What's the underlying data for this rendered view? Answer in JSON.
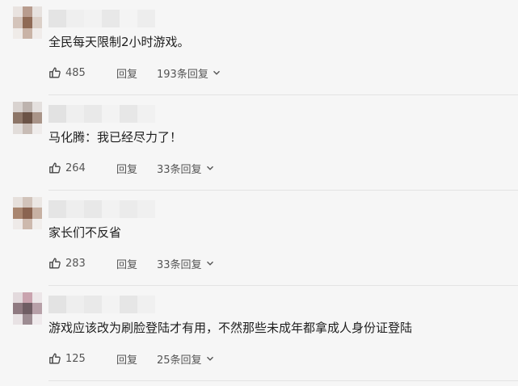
{
  "comments": [
    {
      "text": "全民每天限制2小时游戏。",
      "likes": "485",
      "reply_label": "回复",
      "replies_label": "193条回复",
      "avatar_colors": [
        "#e9e3e0",
        "#b89c8e",
        "#e7e2df",
        "#d4c4bb",
        "#8f6a55",
        "#dcd0c8",
        "#efebe8",
        "#c9b3a6",
        "#f0ecea"
      ],
      "name_colors": [
        "#e4e4e4",
        "#efefef",
        "#f2f2f2",
        "#e8e8e8",
        "#f4f4f4",
        "#ededed"
      ]
    },
    {
      "text": "马化腾：我已经尽力了！",
      "likes": "264",
      "reply_label": "回复",
      "replies_label": "33条回复",
      "avatar_colors": [
        "#d9d3d0",
        "#bdb3ae",
        "#e4e0de",
        "#8d7668",
        "#6b5346",
        "#a99488",
        "#e2ddda",
        "#c8bcb5",
        "#efeceb"
      ],
      "name_colors": [
        "#e2e2e2",
        "#efefef",
        "#e9e9e9",
        "#f3f3f3",
        "#e7e7e7",
        "#f1f1f1"
      ]
    },
    {
      "text": "家长们不反省",
      "likes": "283",
      "reply_label": "回复",
      "replies_label": "33条回复",
      "avatar_colors": [
        "#e6e0dc",
        "#d1c3ba",
        "#ebe7e4",
        "#a98670",
        "#8a6450",
        "#c7b1a3",
        "#eeeae8",
        "#cdb9ad",
        "#f1eeec"
      ],
      "name_colors": [
        "#e5e5e5",
        "#eeeeee",
        "#e8e8e8",
        "#f2f2f2",
        "#ebebeb",
        "#f0f0f0"
      ]
    },
    {
      "text": "游戏应该改为刷脸登陆才有用，不然那些未成年都拿成人身份证登陆",
      "likes": "125",
      "reply_label": "回复",
      "replies_label": "25条回复",
      "avatar_colors": [
        "#e3dadd",
        "#c9a3ae",
        "#ece6e8",
        "#8f7a81",
        "#6f5d63",
        "#b7a0a8",
        "#e8e2e4",
        "#9d8c92",
        "#efeaec"
      ],
      "name_colors": [
        "#e3e3e3",
        "#eeeeee",
        "#e9e9e9",
        "#f3f3f3",
        "#e6e6e6",
        "#f0f0f0"
      ]
    }
  ]
}
